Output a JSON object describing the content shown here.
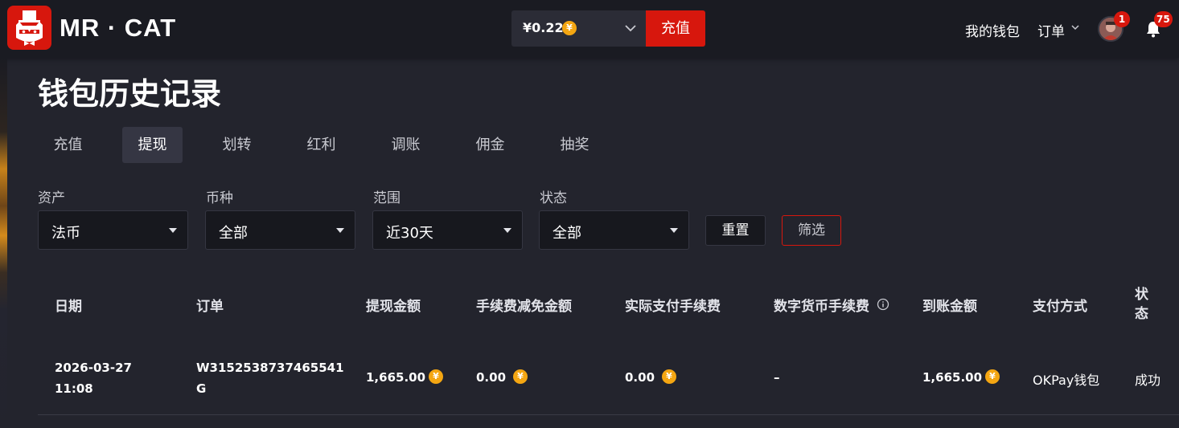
{
  "header": {
    "brand": "MR · CAT",
    "balance": "¥0.22",
    "coin_symbol": "¥",
    "deposit_label": "充值",
    "wallet_link": "我的钱包",
    "orders_link": "订单",
    "avatar_badge": "1",
    "notification_badge": "75"
  },
  "page": {
    "title": "钱包历史记录",
    "tabs": [
      {
        "label": "充值",
        "active": false
      },
      {
        "label": "提现",
        "active": true
      },
      {
        "label": "划转",
        "active": false
      },
      {
        "label": "红利",
        "active": false
      },
      {
        "label": "调账",
        "active": false
      },
      {
        "label": "佣金",
        "active": false
      },
      {
        "label": "抽奖",
        "active": false
      }
    ]
  },
  "filters": {
    "asset": {
      "label": "资产",
      "value": "法币"
    },
    "currency": {
      "label": "币种",
      "value": "全部"
    },
    "range": {
      "label": "范围",
      "value": "近30天"
    },
    "status": {
      "label": "状态",
      "value": "全部"
    },
    "reset_label": "重置",
    "filter_label": "筛选"
  },
  "table": {
    "columns": {
      "date": "日期",
      "order": "订单",
      "withdraw_amount": "提现金额",
      "fee_waived": "手续费减免金额",
      "fee_paid": "实际支付手续费",
      "crypto_fee": "数字货币手续费",
      "received_amount": "到账金额",
      "payment_method": "支付方式",
      "status": "状态"
    },
    "rows": [
      {
        "date": "2026-03-27",
        "time": "11:08",
        "order_line1": "W3152538737465541",
        "order_line2": "G",
        "withdraw_amount": "1,665.00",
        "fee_waived": "0.00",
        "fee_paid": "0.00",
        "crypto_fee": "–",
        "received_amount": "1,665.00",
        "payment_method": "OKPay钱包",
        "status": "成功"
      }
    ]
  },
  "colors": {
    "brand_red": "#d7170d",
    "coin_gold": "#f4a612",
    "background": "#23242d",
    "topbar": "#1a1b22"
  }
}
